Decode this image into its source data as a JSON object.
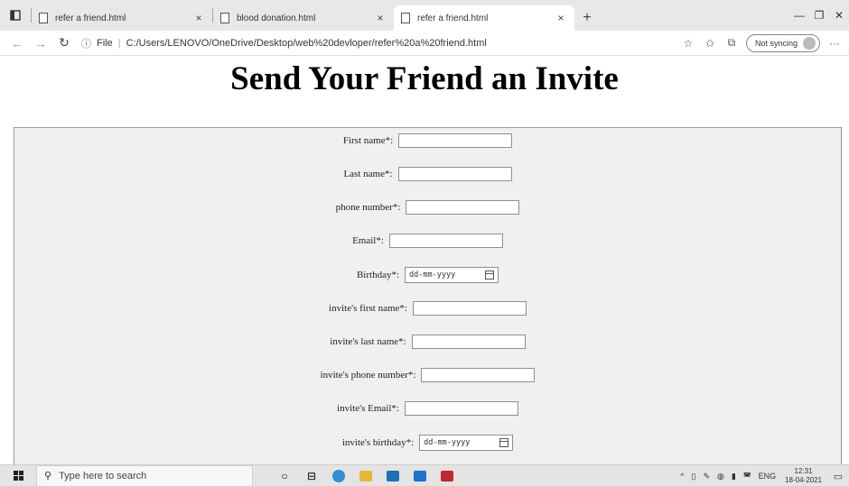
{
  "browser": {
    "tabs": [
      {
        "label": "refer a friend.html",
        "active": false
      },
      {
        "label": "blood donation.html",
        "active": false
      },
      {
        "label": "refer a friend.html",
        "active": true
      }
    ],
    "new_tab": "+",
    "close_tab": "×",
    "address": {
      "scheme_label": "File",
      "url": "C:/Users/LENOVO/OneDrive/Desktop/web%20devloper/refer%20a%20friend.html"
    },
    "sync_label": "Not syncing"
  },
  "page": {
    "title": "Send Your Friend an Invite",
    "fields": [
      {
        "label": "First name*:",
        "type": "text",
        "value": ""
      },
      {
        "label": "Last name*:",
        "type": "text",
        "value": ""
      },
      {
        "label": "phone number*:",
        "type": "text",
        "value": ""
      },
      {
        "label": "Email*:",
        "type": "text",
        "value": ""
      },
      {
        "label": "Birthday*:",
        "type": "date",
        "placeholder": "dd-mm-yyyy"
      },
      {
        "label": "invite's first name*:",
        "type": "text",
        "value": ""
      },
      {
        "label": "invite's last name*:",
        "type": "text",
        "value": ""
      },
      {
        "label": "invite's phone number*:",
        "type": "text",
        "value": ""
      },
      {
        "label": "invite's Email*:",
        "type": "text",
        "value": ""
      },
      {
        "label": "invite's birthday*:",
        "type": "date",
        "placeholder": "dd-mm-yyyy"
      }
    ]
  },
  "taskbar": {
    "search_placeholder": "Type here to search",
    "language": "ENG",
    "time": "12:31",
    "date": "18-04-2021"
  }
}
